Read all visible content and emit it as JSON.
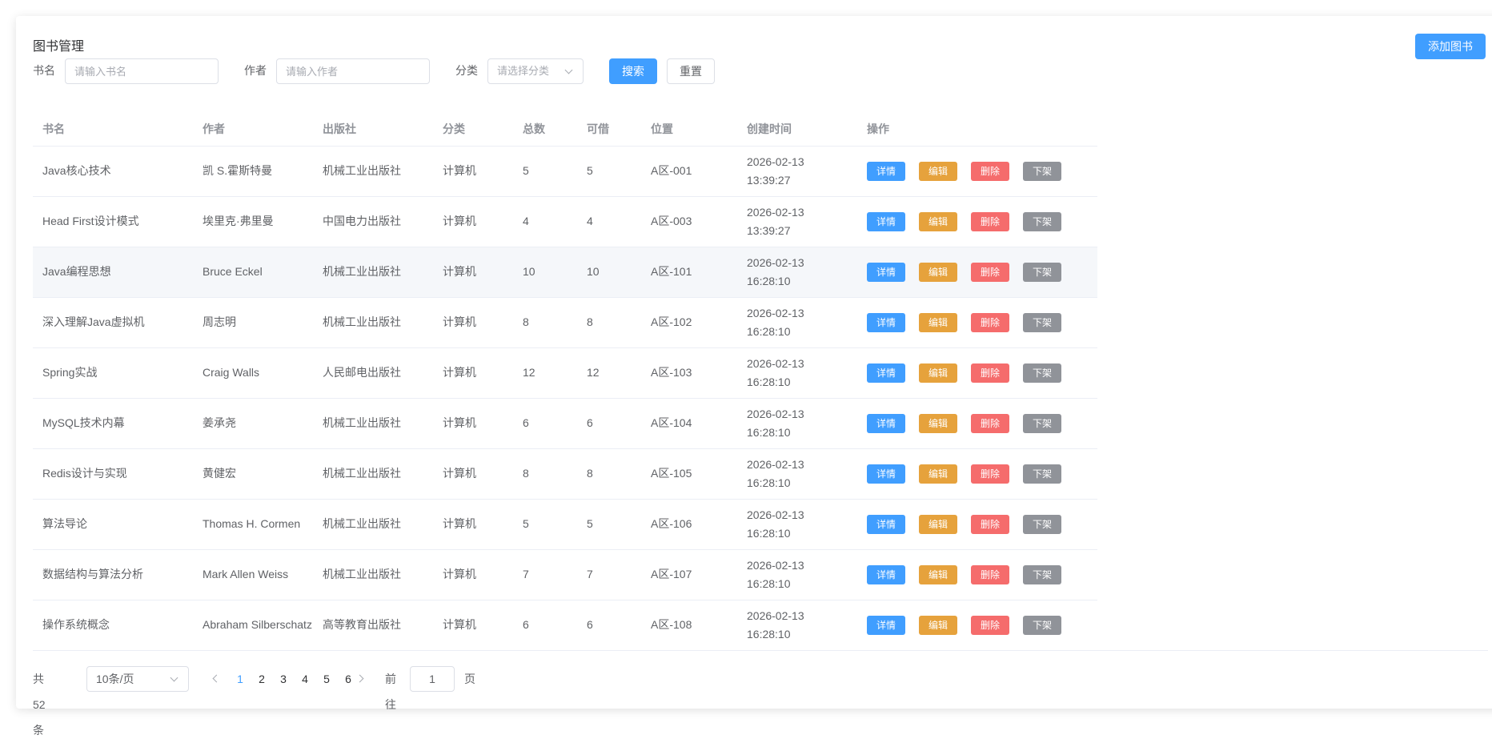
{
  "page": {
    "title": "图书管理",
    "add_button": "添加图书"
  },
  "filters": {
    "name_label": "书名",
    "name_placeholder": "请输入书名",
    "author_label": "作者",
    "author_placeholder": "请输入作者",
    "category_label": "分类",
    "category_placeholder": "请选择分类",
    "search_button": "搜索",
    "reset_button": "重置"
  },
  "table": {
    "headers": {
      "name": "书名",
      "author": "作者",
      "publisher": "出版社",
      "category": "分类",
      "total": "总数",
      "available": "可借",
      "location": "位置",
      "created": "创建时间",
      "actions": "操作"
    },
    "action_labels": {
      "detail": "详情",
      "edit": "编辑",
      "delete": "删除",
      "off_shelf": "下架"
    },
    "rows": [
      {
        "name": "Java核心技术",
        "author": "凯 S.霍斯特曼",
        "publisher": "机械工业出版社",
        "category": "计算机",
        "total": "5",
        "available": "5",
        "location": "A区-001",
        "date": "2026-02-13",
        "time": "13:39:27"
      },
      {
        "name": "Head First设计模式",
        "author": "埃里克·弗里曼",
        "publisher": "中国电力出版社",
        "category": "计算机",
        "total": "4",
        "available": "4",
        "location": "A区-003",
        "date": "2026-02-13",
        "time": "13:39:27"
      },
      {
        "name": "Java编程思想",
        "author": "Bruce Eckel",
        "publisher": "机械工业出版社",
        "category": "计算机",
        "total": "10",
        "available": "10",
        "location": "A区-101",
        "date": "2026-02-13",
        "time": "16:28:10"
      },
      {
        "name": "深入理解Java虚拟机",
        "author": "周志明",
        "publisher": "机械工业出版社",
        "category": "计算机",
        "total": "8",
        "available": "8",
        "location": "A区-102",
        "date": "2026-02-13",
        "time": "16:28:10"
      },
      {
        "name": "Spring实战",
        "author": "Craig Walls",
        "publisher": "人民邮电出版社",
        "category": "计算机",
        "total": "12",
        "available": "12",
        "location": "A区-103",
        "date": "2026-02-13",
        "time": "16:28:10"
      },
      {
        "name": "MySQL技术内幕",
        "author": "姜承尧",
        "publisher": "机械工业出版社",
        "category": "计算机",
        "total": "6",
        "available": "6",
        "location": "A区-104",
        "date": "2026-02-13",
        "time": "16:28:10"
      },
      {
        "name": "Redis设计与实现",
        "author": "黄健宏",
        "publisher": "机械工业出版社",
        "category": "计算机",
        "total": "8",
        "available": "8",
        "location": "A区-105",
        "date": "2026-02-13",
        "time": "16:28:10"
      },
      {
        "name": "算法导论",
        "author": "Thomas H. Cormen",
        "publisher": "机械工业出版社",
        "category": "计算机",
        "total": "5",
        "available": "5",
        "location": "A区-106",
        "date": "2026-02-13",
        "time": "16:28:10"
      },
      {
        "name": "数据结构与算法分析",
        "author": "Mark Allen Weiss",
        "publisher": "机械工业出版社",
        "category": "计算机",
        "total": "7",
        "available": "7",
        "location": "A区-107",
        "date": "2026-02-13",
        "time": "16:28:10"
      },
      {
        "name": "操作系统概念",
        "author": "Abraham Silberschatz",
        "publisher": "高等教育出版社",
        "category": "计算机",
        "total": "6",
        "available": "6",
        "location": "A区-108",
        "date": "2026-02-13",
        "time": "16:28:10"
      }
    ]
  },
  "pagination": {
    "total_text": "共 52 条",
    "page_size": "10条/页",
    "pages": [
      "1",
      "2",
      "3",
      "4",
      "5",
      "6"
    ],
    "current_page": "1",
    "goto_prefix": "前往",
    "goto_value": "1",
    "goto_suffix": "页"
  },
  "colors": {
    "primary": "#409eff",
    "warning": "#e6a23c",
    "danger": "#f56c6c",
    "info": "#909399",
    "hover_row": "#f5f7fa"
  },
  "icons": {
    "select_arrow": "chevron-down-icon",
    "prev": "chevron-left-icon",
    "next": "chevron-right-icon"
  }
}
